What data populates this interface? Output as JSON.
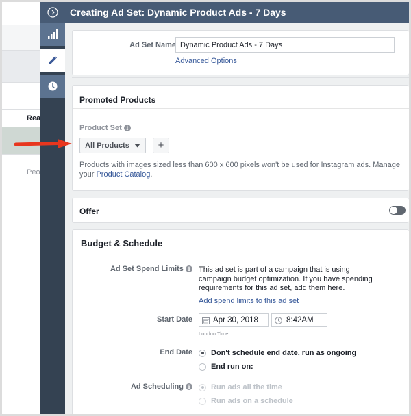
{
  "background_page": {
    "column_header": "Reac",
    "row_text": "Peop"
  },
  "drawer": {
    "title": "Creating Ad Set: Dynamic Product Ads - 7 Days",
    "rail_tabs": [
      {
        "icon": "bar-chart-icon",
        "active": false
      },
      {
        "icon": "pencil-icon",
        "active": true
      },
      {
        "icon": "clock-icon",
        "active": false
      }
    ]
  },
  "ad_set_name": {
    "label": "Ad Set Name",
    "value": "Dynamic Product Ads - 7 Days",
    "advanced_options_link": "Advanced Options"
  },
  "promoted_products": {
    "title": "Promoted Products",
    "product_set_label": "Product Set",
    "product_set_value": "All Products",
    "add_button": "+",
    "note": "Products with images sized less than 600 x 600 pixels won't be used for Instagram ads. Manage your",
    "catalog_link": "Product Catalog",
    "catalog_suffix": "."
  },
  "offer": {
    "title": "Offer",
    "enabled": false
  },
  "budget_schedule": {
    "title": "Budget & Schedule",
    "spend_limits_label": "Ad Set Spend Limits",
    "spend_limits_text": "This ad set is part of a campaign that is using campaign budget optimization. If you have spending requirements for this ad set, add them here.",
    "spend_limits_link": "Add spend limits to this ad set",
    "start_date_label": "Start Date",
    "start_date": "Apr 30, 2018",
    "start_time": "8:42AM",
    "timezone": "London Time",
    "end_date_label": "End Date",
    "end_date_options": [
      {
        "label": "Don't schedule end date, run as ongoing",
        "selected": true
      },
      {
        "label": "End run on:",
        "selected": false
      }
    ],
    "ad_scheduling_label": "Ad Scheduling",
    "ad_scheduling_options": [
      {
        "label": "Run ads all the time",
        "selected": true,
        "disabled": true
      },
      {
        "label": "Run ads on a schedule",
        "selected": false,
        "disabled": true
      }
    ]
  },
  "colors": {
    "header": "#475b75",
    "rail": "#344252",
    "link": "#365899",
    "annotation_arrow": "#e8361e"
  }
}
